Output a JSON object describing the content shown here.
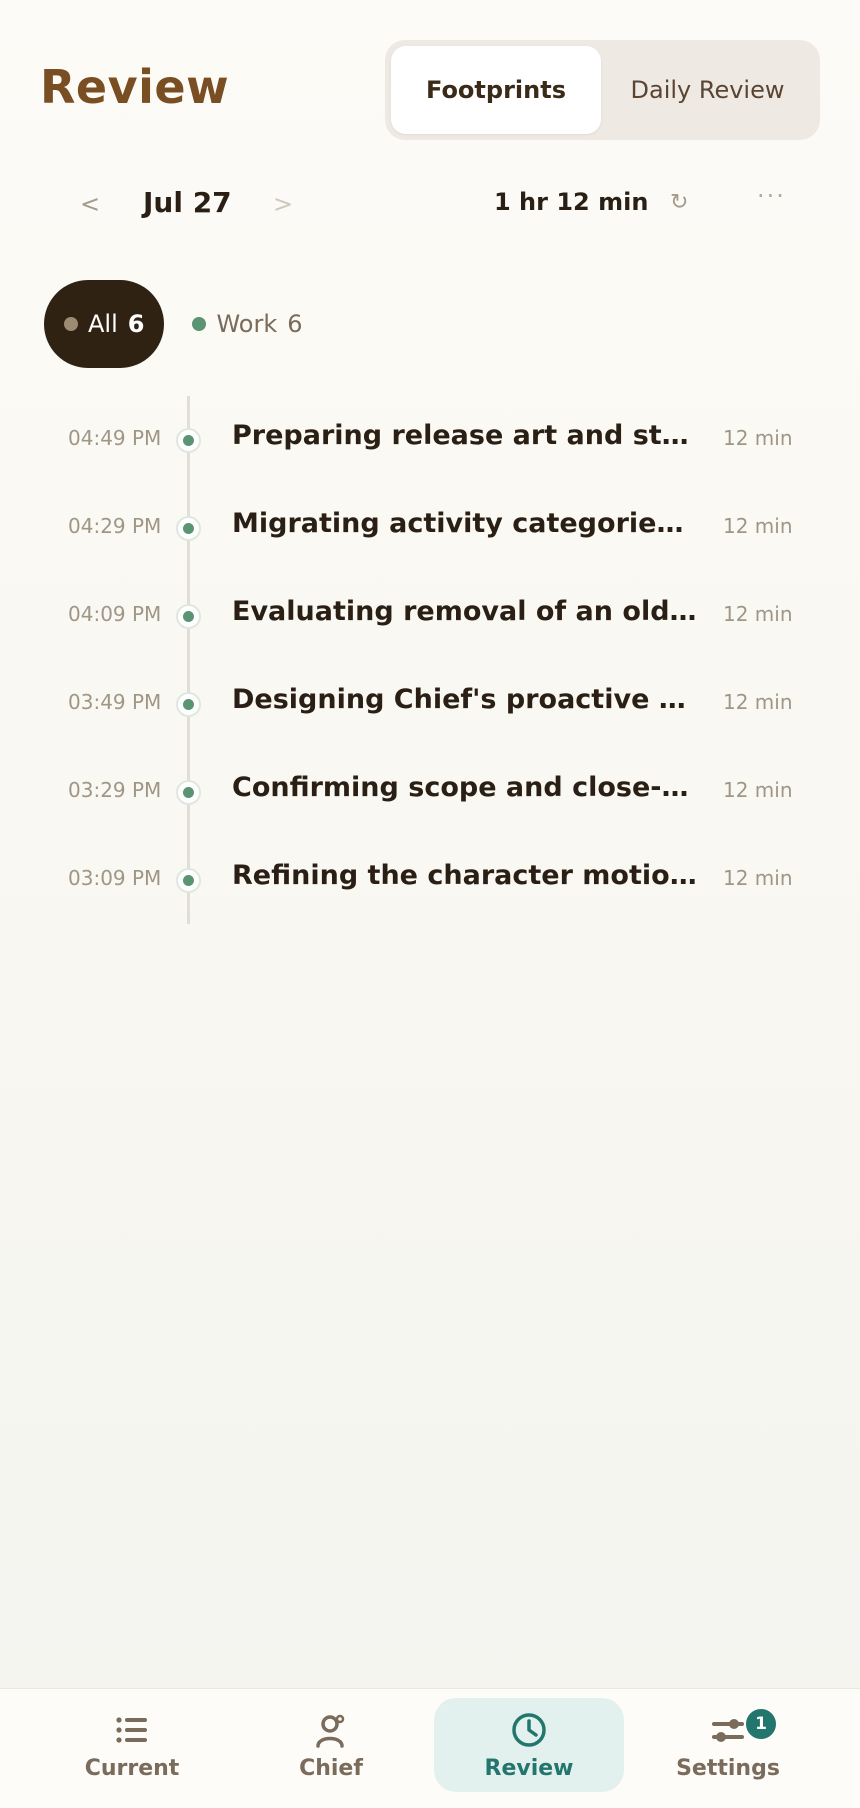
{
  "header": {
    "title": "Review",
    "tabs": [
      {
        "label": "Footprints",
        "active": true
      },
      {
        "label": "Daily Review",
        "active": false
      }
    ]
  },
  "datebar": {
    "prev_icon": "<",
    "date": "Jul 27",
    "next_icon": ">",
    "total": "1 hr 12 min",
    "refresh_icon": "↻",
    "more_icon": "···"
  },
  "filters": [
    {
      "label": "All",
      "count": "6",
      "dot_color": "#9c8a73",
      "active": true
    },
    {
      "label": "Work",
      "count": "6",
      "dot_color": "#5a9472",
      "active": false
    }
  ],
  "timeline": [
    {
      "time": "04:49 PM",
      "title": "Preparing release art and store listing",
      "duration": "12 min"
    },
    {
      "time": "04:29 PM",
      "title": "Migrating activity categories and data",
      "duration": "12 min"
    },
    {
      "time": "04:09 PM",
      "title": "Evaluating removal of an old module",
      "duration": "12 min"
    },
    {
      "time": "03:49 PM",
      "title": "Designing Chief's proactive organization",
      "duration": "12 min"
    },
    {
      "time": "03:29 PM",
      "title": "Confirming scope and close-out",
      "duration": "12 min"
    },
    {
      "time": "03:09 PM",
      "title": "Refining the character motion system",
      "duration": "12 min"
    }
  ],
  "bottom_nav": [
    {
      "label": "Current",
      "icon": "list-icon",
      "active": false
    },
    {
      "label": "Chief",
      "icon": "person-icon",
      "active": false
    },
    {
      "label": "Review",
      "icon": "clock-icon",
      "active": true
    },
    {
      "label": "Settings",
      "icon": "sliders-icon",
      "active": false,
      "badge": "1"
    }
  ],
  "colors": {
    "title": "#7a4e23",
    "accent": "#23766d",
    "work_green": "#5a9472",
    "chip_dark": "#2f2213"
  }
}
